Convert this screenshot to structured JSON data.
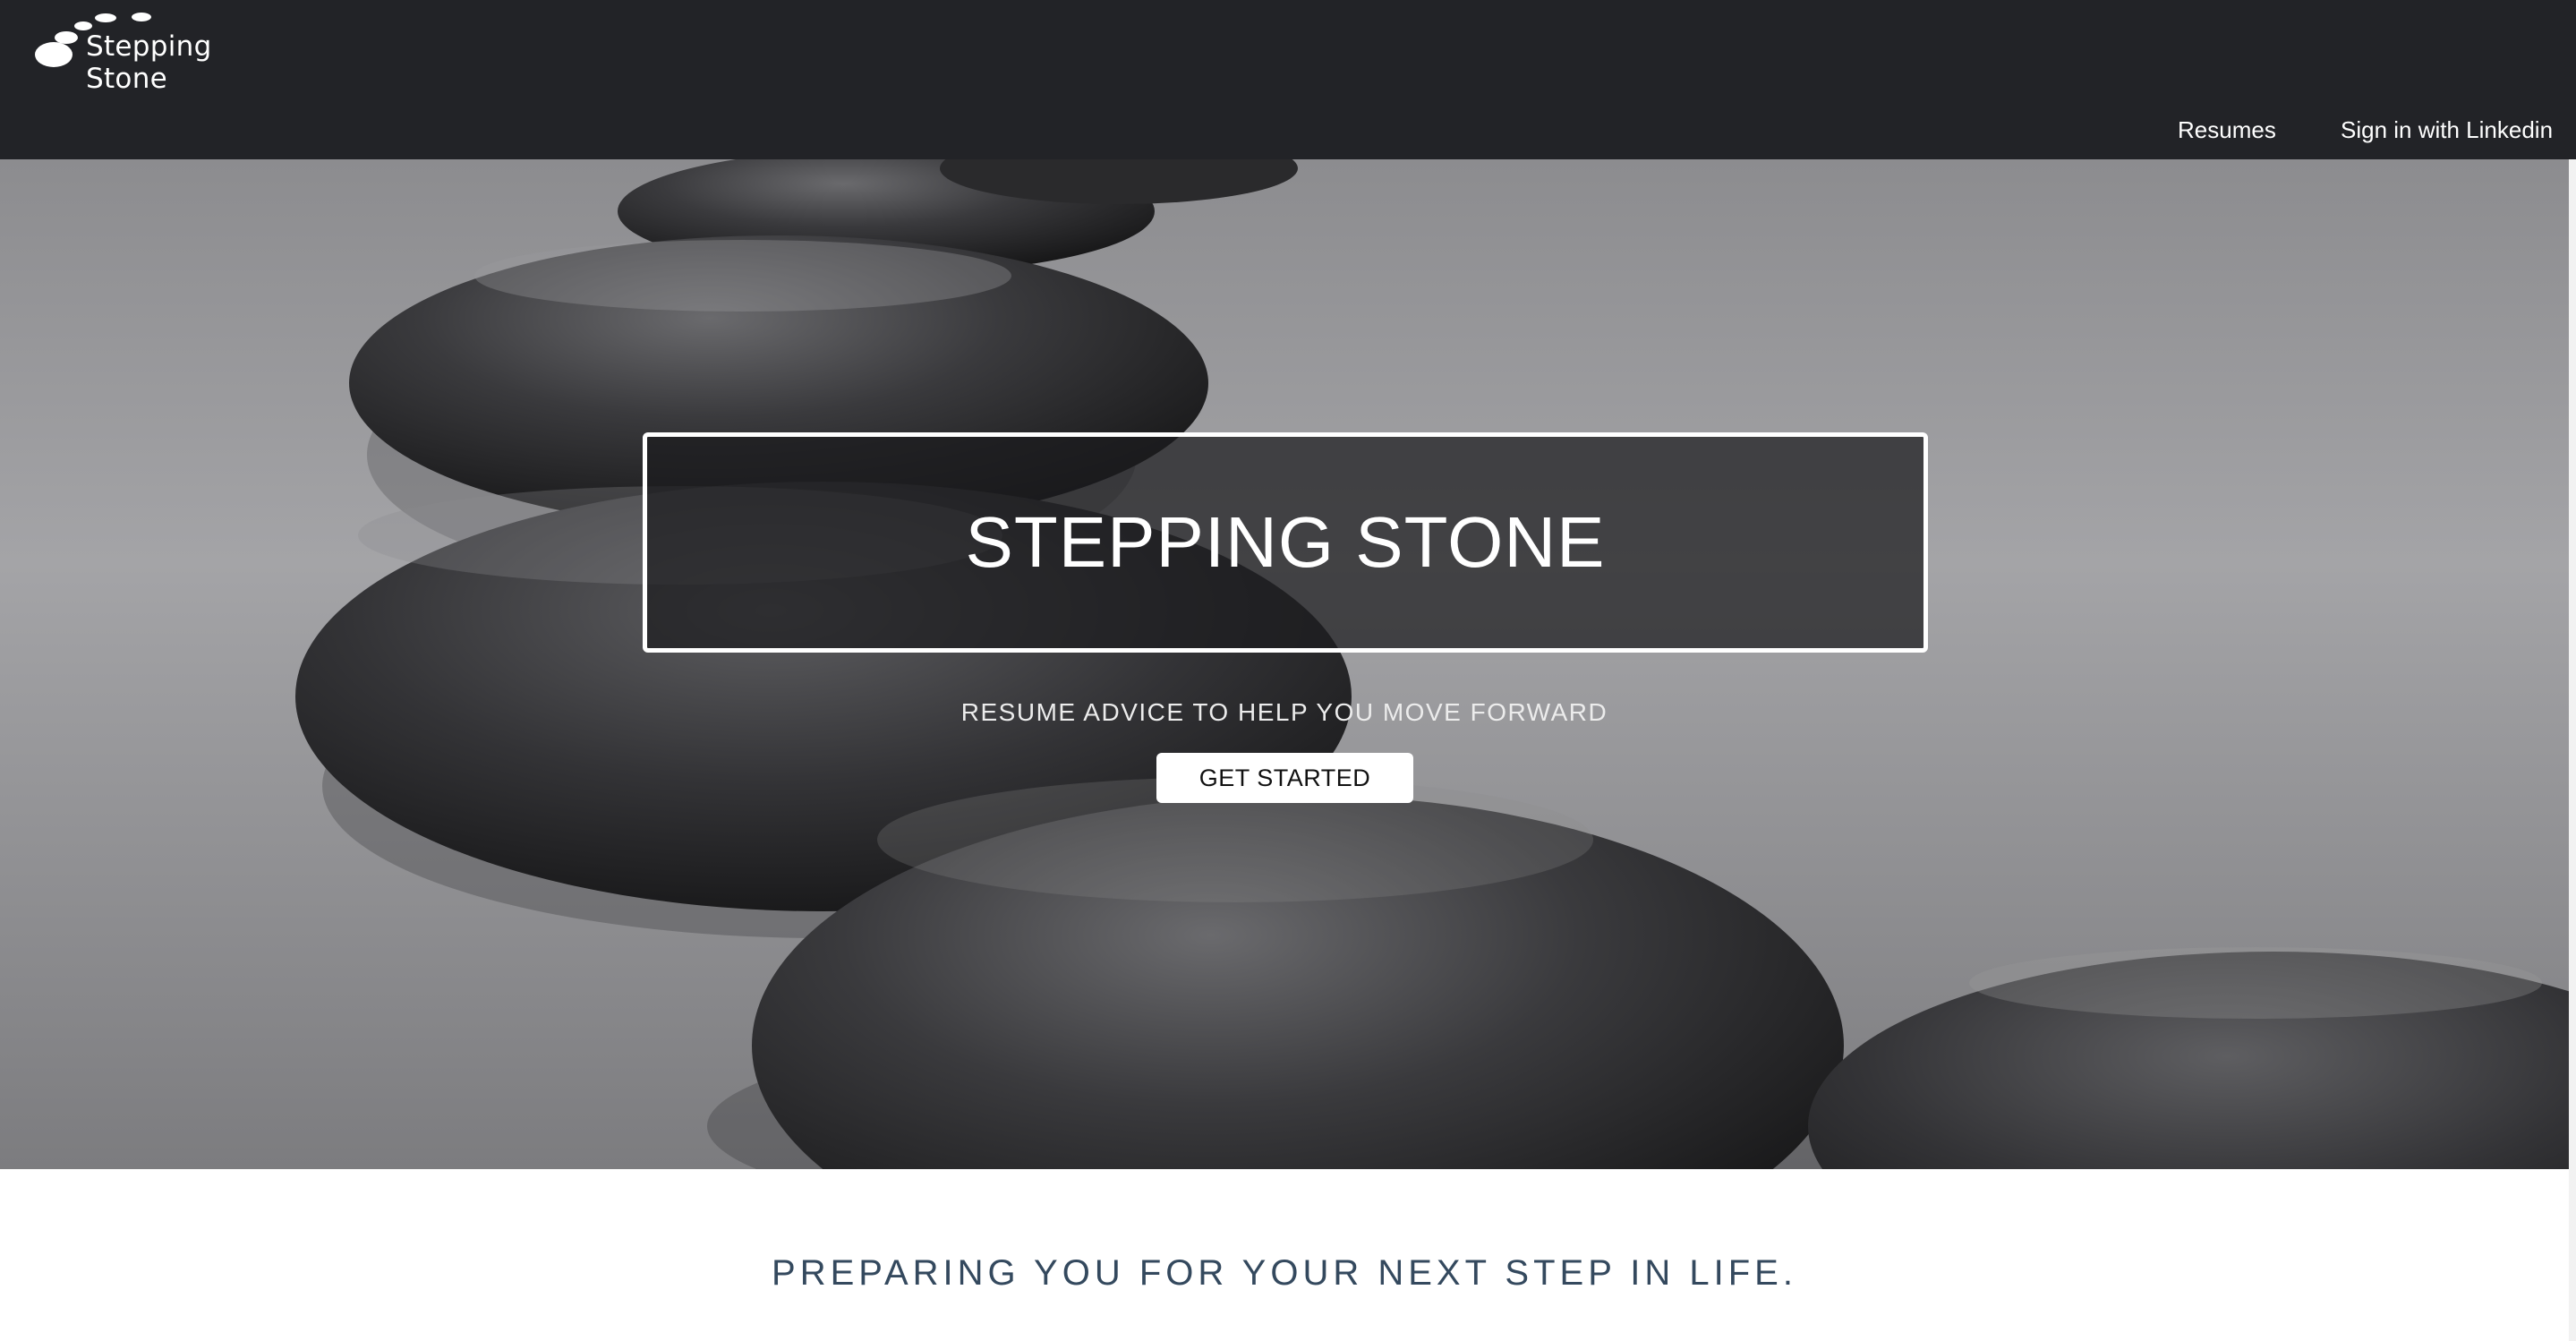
{
  "brand": {
    "logo_text": "Stepping Stone",
    "logo_icon": "stepping-stones-logo-icon"
  },
  "nav": {
    "links": [
      {
        "label": "Resumes"
      },
      {
        "label": "Sign in with Linkedin"
      }
    ]
  },
  "hero": {
    "title": "STEPPING STONE",
    "tagline": "RESUME ADVICE TO HELP YOU MOVE FORWARD",
    "cta_label": "GET STARTED"
  },
  "section": {
    "heading": "PREPARING YOU FOR YOUR NEXT STEP IN LIFE."
  },
  "colors": {
    "navbar_bg": "#222327",
    "hero_overlay": "#1c1c1e",
    "heading_text": "#34495e",
    "button_bg": "#ffffff"
  }
}
